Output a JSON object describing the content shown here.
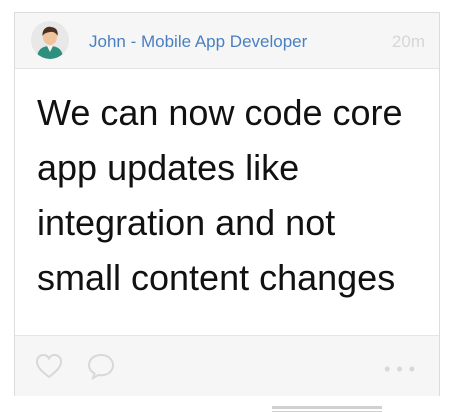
{
  "post": {
    "author": "John - Mobile App Developer",
    "time": "20m",
    "text": "We can now code core app updates like integration and not small content changes"
  },
  "actions": {
    "like_icon": "heart-outline",
    "comment_icon": "speech-bubble-outline",
    "more_icon": "ellipsis"
  },
  "colors": {
    "author": "#4a7fc1",
    "time": "#d6d6d6",
    "header_bg": "#f6f6f6",
    "footer_bg": "#f6f6f6",
    "text": "#111111"
  }
}
